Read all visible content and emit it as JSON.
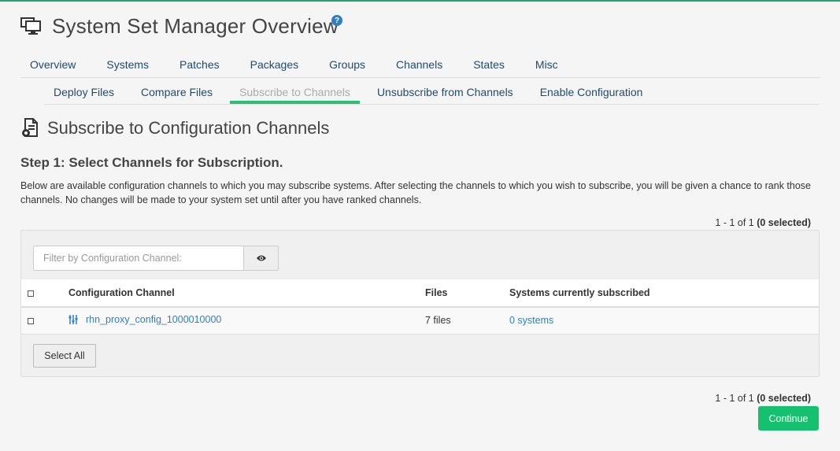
{
  "header": {
    "title": "System Set Manager Overview",
    "help": "?"
  },
  "nav_primary": [
    "Overview",
    "Systems",
    "Patches",
    "Packages",
    "Groups",
    "Channels",
    "States",
    "Misc"
  ],
  "nav_secondary": [
    "Deploy Files",
    "Compare Files",
    "Subscribe to Channels",
    "Unsubscribe from Channels",
    "Enable Configuration"
  ],
  "nav_secondary_active": "Subscribe to Channels",
  "section": {
    "title": "Subscribe to Configuration Channels",
    "step": "Step 1: Select Channels for Subscription.",
    "description": "Below are available configuration channels to which you may subscribe systems. After selecting the channels to which you wish to subscribe, you will be given a chance to rank those channels. No changes will be made to your system set until after you have ranked channels."
  },
  "pager": {
    "range": "1 - 1 of 1",
    "selected": "(0 selected)"
  },
  "filter": {
    "placeholder": "Filter by Configuration Channel:",
    "value": ""
  },
  "table": {
    "columns": [
      "Configuration Channel",
      "Files",
      "Systems currently subscribed"
    ],
    "rows": [
      {
        "channel": "rhn_proxy_config_1000010000",
        "files": "7 files",
        "systems": "0 systems",
        "checked": false
      }
    ]
  },
  "buttons": {
    "select_all": "Select All",
    "continue": "Continue"
  },
  "colors": {
    "accent_green": "#15c06f",
    "tab_active_underline": "#2dbd75",
    "link_blue": "#2f7fc1",
    "nav_text": "#1f4a6e"
  },
  "icons": {
    "header": "system-set-icon",
    "help": "help-icon",
    "section": "config-document-icon",
    "filter_toggle": "eye-icon",
    "channel": "config-channel-icon"
  }
}
